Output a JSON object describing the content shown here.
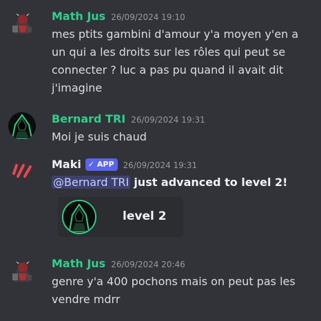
{
  "messages": [
    {
      "username": "Math Jus",
      "timestamp": "26/09/2024 19:10",
      "lines": [
        "mes ptits gambini d'amour y'a moyen y'en a",
        "un qui a les droits sur les rôles qui peut se",
        "connecter ? luc a pas pu quand il avait dit",
        "j'imagine"
      ]
    },
    {
      "username": "Bernard TRI",
      "timestamp": "26/09/2024 19:31",
      "lines": [
        "Moi je suis chaud"
      ]
    },
    {
      "username": "Maki",
      "badge": "APP",
      "timestamp": "26/09/2024 19:31",
      "mention": "@Bernard TRI",
      "text": "just advanced to level 2!",
      "card_label": "level 2"
    },
    {
      "username": "Math Jus",
      "timestamp": "26/09/2024 20:46",
      "lines": [
        "genre y'a 400 pochons mais on peut pas les",
        "vendre mdrr"
      ]
    }
  ],
  "colors": {
    "background": "#313338",
    "username_green": "#2dd18a",
    "app_badge": "#5865f2",
    "maki_red": "#e8484d"
  }
}
